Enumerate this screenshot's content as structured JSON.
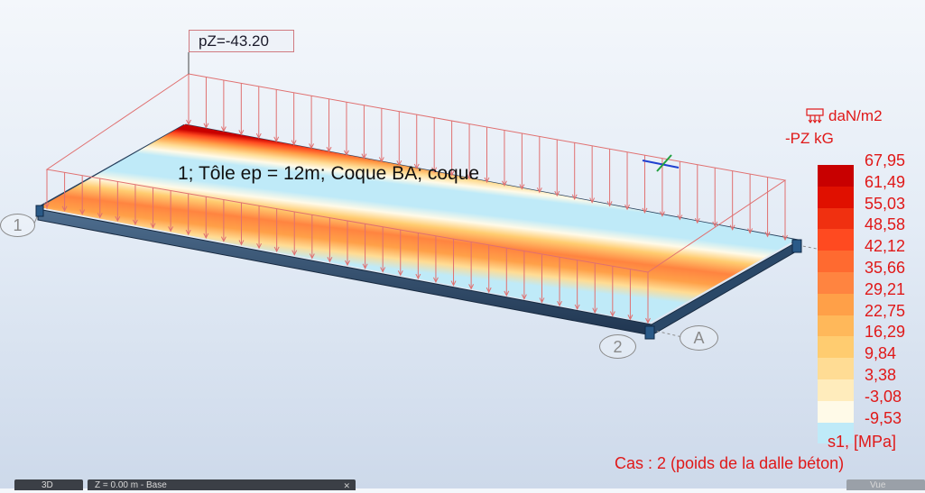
{
  "load": {
    "label": "pZ=-43.20"
  },
  "panel": {
    "title": "1; Tôle ep = 12m; Coque BA; coque"
  },
  "legend": {
    "unit_line1": "daN/m2",
    "unit_line2": "-PZ  kG",
    "icon": "load-pattern-icon",
    "values": [
      "67,95",
      "61,49",
      "55,03",
      "48,58",
      "42,12",
      "35,66",
      "29,21",
      "22,75",
      "16,29",
      "9,84",
      "3,38",
      "-3,08",
      "-9,53"
    ],
    "colors": [
      "#c80000",
      "#e01000",
      "#f03010",
      "#ff4a20",
      "#ff6a30",
      "#ff8440",
      "#ffa048",
      "#ffb85a",
      "#ffcc70",
      "#ffdc94",
      "#ffecbc",
      "#fffae8",
      "#bfeaf8"
    ],
    "result_label": "s1, [MPa]"
  },
  "case": {
    "label": "Cas : 2 (poids de la dalle béton)"
  },
  "axes": {
    "one": "1",
    "two": "2",
    "a": "A"
  },
  "tabs": [
    {
      "label": "3D"
    },
    {
      "label": "Z = 0.00 m - Base"
    },
    {
      "label": "Vue"
    }
  ]
}
